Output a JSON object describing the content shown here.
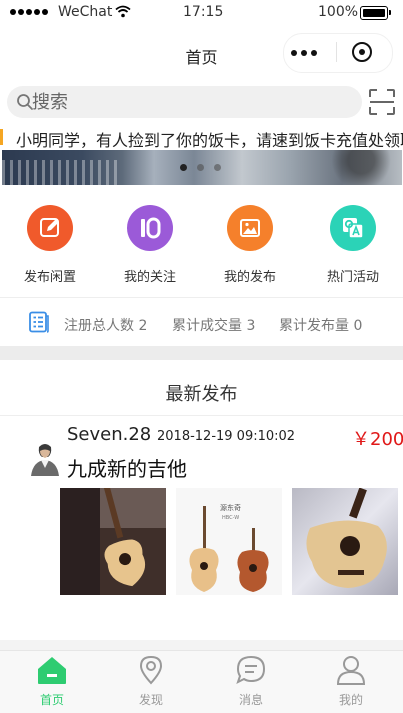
{
  "status_bar": {
    "carrier": "WeChat",
    "time": "17:15",
    "battery": "100%"
  },
  "nav": {
    "title": "首页"
  },
  "search": {
    "placeholder": "搜索"
  },
  "notice": {
    "text": "小明同学，有人捡到了你的饭卡，请速到饭卡充值处领取"
  },
  "banner": {
    "total_slides": 3,
    "active_slide": 1
  },
  "shortcuts": [
    {
      "label": "发布闲置",
      "icon": "edit-icon",
      "color": "#f05a2b"
    },
    {
      "label": "我的关注",
      "icon": "follow-10-icon",
      "color": "#9b5ad8"
    },
    {
      "label": "我的发布",
      "icon": "image-icon",
      "color": "#f5802b"
    },
    {
      "label": "热门活动",
      "icon": "qa-icon",
      "color": "#2bd3b7"
    }
  ],
  "stats": {
    "icon": "document-list-icon",
    "registered": "注册总人数 2",
    "deals": "累计成交量 3",
    "posts": "累计发布量 0"
  },
  "latest": {
    "title": "最新发布",
    "post": {
      "user": "Seven.28",
      "time": "2018-12-19 09:10:02",
      "price": "￥200",
      "title": "九成新的吉他",
      "photo_label": "源东奇",
      "photo_sub": "HBC-W"
    }
  },
  "tabbar": {
    "active": 0,
    "active_color": "#2ecc71",
    "inactive_color": "#999999",
    "tabs": [
      {
        "label": "首页",
        "icon": "home-icon"
      },
      {
        "label": "发现",
        "icon": "location-pin-icon"
      },
      {
        "label": "消息",
        "icon": "message-icon"
      },
      {
        "label": "我的",
        "icon": "user-icon"
      }
    ]
  }
}
